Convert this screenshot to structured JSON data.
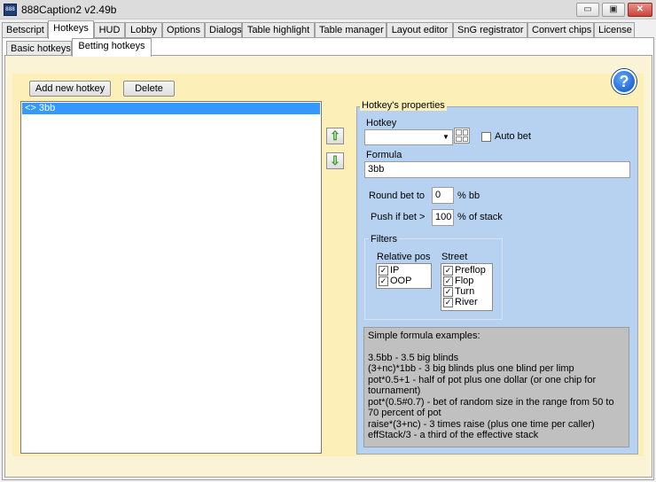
{
  "window": {
    "title": "888Caption2 v2.49b",
    "icon": "app-icon",
    "minimize_label": "▭",
    "maximize_label": "▣",
    "close_label": "✕"
  },
  "main_tabs": [
    "Betscript",
    "Hotkeys",
    "HUD",
    "Lobby",
    "Options",
    "Dialogs",
    "Table highlight",
    "Table manager",
    "Layout editor",
    "SnG registrator",
    "Convert chips",
    "License"
  ],
  "main_tab_active": "Hotkeys",
  "sub_tabs": [
    "Basic hotkeys",
    "Betting hotkeys"
  ],
  "sub_tab_active": "Betting hotkeys",
  "toolbar": {
    "add_label": "Add new hotkey",
    "delete_label": "Delete",
    "help_label": "?"
  },
  "hotkey_list": {
    "items": [
      "<> 3bb"
    ],
    "selected_index": 0
  },
  "move_buttons": {
    "up": "⇧",
    "down": "⇩"
  },
  "properties": {
    "legend": "Hotkey's properties",
    "hotkey_label": "Hotkey",
    "hotkey_value": "",
    "auto_bet_label": "Auto bet",
    "auto_bet_checked": false,
    "formula_label": "Formula",
    "formula_value": "3bb",
    "round_label": "Round bet to",
    "round_value": "0",
    "round_unit": "% bb",
    "push_label": "Push if bet >",
    "push_value": "100",
    "push_unit": "% of stack"
  },
  "filters": {
    "legend": "Filters",
    "relative_pos_label": "Relative pos",
    "relative_pos": [
      {
        "label": "IP",
        "checked": true
      },
      {
        "label": "OOP",
        "checked": true
      }
    ],
    "street_label": "Street",
    "street": [
      {
        "label": "Preflop",
        "checked": true
      },
      {
        "label": "Flop",
        "checked": true
      },
      {
        "label": "Turn",
        "checked": true
      },
      {
        "label": "River",
        "checked": true
      }
    ]
  },
  "examples": {
    "heading": "Simple formula examples:",
    "lines": [
      "3.5bb - 3.5 big blinds",
      "(3+nc)*1bb - 3 big blinds plus one blind per limp",
      "pot*0.5+1 - half of pot plus one dollar (or one chip for tournament)",
      "pot*(0.5#0.7) - bet of random size in the range from 50 to 70 percent of pot",
      "raise*(3+nc) - 3 times raise (plus one time per caller)",
      "effStack/3 - a third of the effective stack"
    ]
  },
  "colors": {
    "panel_bg": "#fcefb8",
    "props_bg": "#b7d2f0",
    "selection": "#3399ff",
    "examples_bg": "#c0c0c0"
  }
}
